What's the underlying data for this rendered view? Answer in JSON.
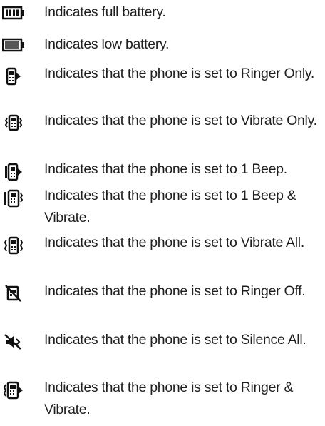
{
  "legend": {
    "items": [
      {
        "icon": "full-battery-icon",
        "text": "Indicates full battery."
      },
      {
        "icon": "low-battery-icon",
        "text": "Indicates low battery."
      },
      {
        "icon": "ringer-only-icon",
        "text": "Indicates that the phone is set to Ringer Only."
      },
      {
        "icon": "vibrate-only-icon",
        "text": "Indicates that the phone is set to Vibrate Only."
      },
      {
        "icon": "one-beep-icon",
        "text": "Indicates that the phone is set to 1 Beep."
      },
      {
        "icon": "one-beep-vibrate-icon",
        "text": "Indicates that the phone is set to 1 Beep & Vibrate."
      },
      {
        "icon": "vibrate-all-icon",
        "text": "Indicates that the phone is set to Vibrate All."
      },
      {
        "icon": "ringer-off-icon",
        "text": "Indicates that the phone is set to Ringer Off."
      },
      {
        "icon": "silence-all-icon",
        "text": "Indicates that the phone is set to Silence All."
      },
      {
        "icon": "ringer-vibrate-icon",
        "text": "Indicates that the phone is set to Ringer & Vibrate."
      }
    ]
  }
}
